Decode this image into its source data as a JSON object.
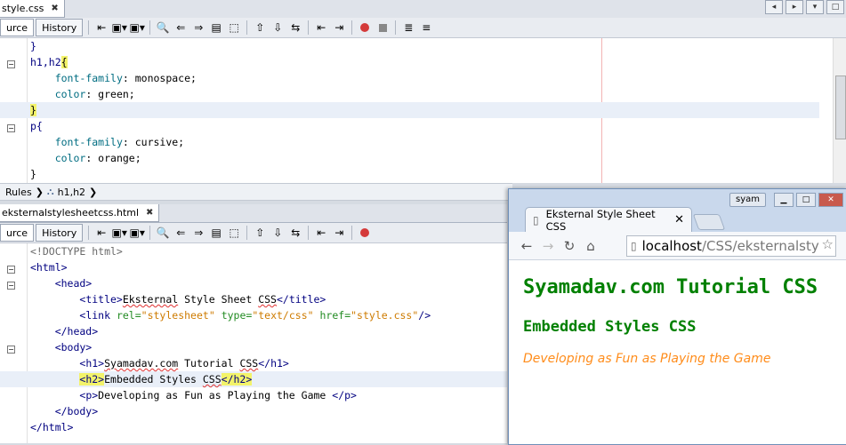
{
  "top_editor": {
    "tab_label": "style.css",
    "tab_close": "✖",
    "source_btn": "urce",
    "history_btn": "History",
    "lines": [
      "}",
      "h1,h2{",
      "    font-family: monospace;",
      "    color: green;",
      "}",
      "p{",
      "    font-family: cursive;",
      "    color: orange;",
      "}"
    ],
    "breadcrumb": [
      "Rules",
      "h1,h2"
    ]
  },
  "bottom_editor": {
    "tab_label": "eksternalstylesheetcss.html",
    "tab_close": "✖",
    "source_btn": "urce",
    "history_btn": "History",
    "lines": [
      "<!DOCTYPE html>",
      "<html>",
      "    <head>",
      "        <title>Eksternal Style Sheet CSS</title>",
      "        <link rel=\"stylesheet\" type=\"text/css\" href=\"style.css\"/>",
      "    </head>",
      "    <body>",
      "        <h1>Syamadav.com Tutorial CSS</h1>",
      "        <h2>Embedded Styles CSS</h2>",
      "        <p>Developing as Fun as Playing the Game </p>",
      "    </body>",
      "</html>"
    ]
  },
  "browser": {
    "tab_title": "Eksternal Style Sheet CSS",
    "tab_close": "✕",
    "user": "syam",
    "url_host": "localhost",
    "url_path": "/CSS/eksternalsty",
    "page": {
      "h1": "Syamadav.com Tutorial CSS",
      "h2": "Embedded Styles CSS",
      "p": "Developing as Fun as Playing the Game"
    }
  },
  "colors": {
    "h1": "#008000",
    "p": "#ff8c1a",
    "highlight": "#f3f36a"
  }
}
